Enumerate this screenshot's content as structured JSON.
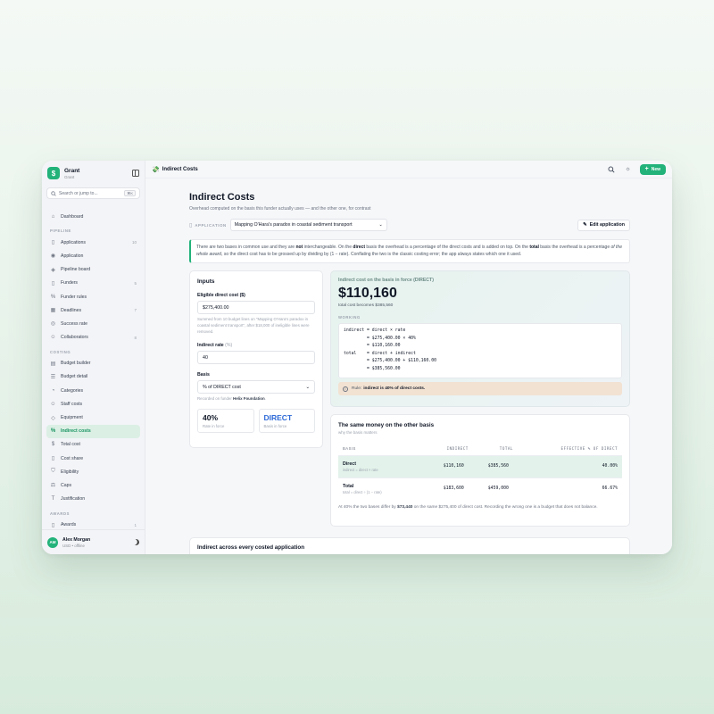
{
  "brand": {
    "name": "Grant",
    "sub": "Grant",
    "logo": "$"
  },
  "search": {
    "placeholder": "Search or jump to...",
    "shortcut": "⌘K"
  },
  "nav": {
    "dashboard": "Dashboard",
    "pipeline_section": "PIPELINE",
    "pipeline": [
      {
        "label": "Applications",
        "count": "10",
        "icon": "file-icon"
      },
      {
        "label": "Application",
        "count": "",
        "icon": "eye-icon"
      },
      {
        "label": "Pipeline board",
        "count": "",
        "icon": "layers-icon"
      },
      {
        "label": "Funders",
        "count": "5",
        "icon": "file-icon"
      },
      {
        "label": "Funder rules",
        "count": "",
        "icon": "percent-icon"
      },
      {
        "label": "Deadlines",
        "count": "7",
        "icon": "calendar-icon"
      },
      {
        "label": "Success rate",
        "count": "",
        "icon": "target-icon"
      },
      {
        "label": "Collaborators",
        "count": "8",
        "icon": "users-icon"
      }
    ],
    "costing_section": "COSTING",
    "costing": [
      {
        "label": "Budget builder",
        "icon": "table-icon"
      },
      {
        "label": "Budget detail",
        "icon": "list-icon"
      },
      {
        "label": "Categories",
        "icon": "pie-icon"
      },
      {
        "label": "Staff costs",
        "icon": "users-icon"
      },
      {
        "label": "Equipment",
        "icon": "box-icon"
      },
      {
        "label": "Indirect costs",
        "icon": "percent-icon"
      },
      {
        "label": "Total cost",
        "icon": "dollar-icon"
      },
      {
        "label": "Cost share",
        "icon": "file-icon"
      },
      {
        "label": "Eligibility",
        "icon": "shield-icon"
      },
      {
        "label": "Caps",
        "icon": "scale-icon"
      },
      {
        "label": "Justification",
        "icon": "type-icon"
      }
    ],
    "awards_section": "AWARDS",
    "awards": [
      {
        "label": "Awards",
        "count": "1"
      }
    ]
  },
  "user": {
    "initials": "AM",
    "name": "Alex Morgan",
    "sub": "USD • offline"
  },
  "topbar": {
    "title": "Indirect Costs",
    "emoji": "💸",
    "new_label": "New"
  },
  "page": {
    "title": "Indirect Costs",
    "subtitle": "Overhead computed on the basis this funder actually uses — and the other one, for contrast",
    "application_label": "APPLICATION",
    "application_value": "Mapping O'Hara's paradox in coastal sediment transport",
    "edit_label": "Edit application"
  },
  "inputs": {
    "title": "Inputs",
    "direct_label": "Eligible direct cost ($)",
    "direct_value": "$275,400.00",
    "direct_hint_1": "Summed from 10 budget lines on \"Mapping O'Hara's paradox in coastal sediment transport\", after $18,000 of ineligible lines were removed.",
    "rate_label": "Indirect rate",
    "rate_unit": "(%)",
    "rate_value": "40",
    "basis_label": "Basis",
    "basis_value": "% of DIRECT cost",
    "basis_hint_prefix": "Recorded on funder",
    "basis_hint_funder": "Helix Foundation",
    "rate_in_force": "40%",
    "rate_in_force_label": "Rate in force",
    "basis_in_force": "DIRECT",
    "basis_in_force_label": "Basis in force"
  },
  "result": {
    "label": "Indirect cost on the basis in force (DIRECT)",
    "amount": "$110,160",
    "total_note": "total cost becomes $385,560",
    "working_label": "WORKING",
    "working_lines": [
      "indirect = direct × rate",
      "         = $275,400.00 × 40%",
      "         = $110,160.00",
      "total    = direct + indirect",
      "         = $275,400.00 + $110,160.00",
      "         = $385,560.00"
    ],
    "rule_prefix": "Rule:",
    "rule_text": "indirect is 40% of direct costs."
  },
  "compare": {
    "title": "The same money on the other basis",
    "subtitle": "why the basis matters",
    "columns": [
      "BASIS",
      "INDIRECT",
      "TOTAL",
      "EFFECTIVE % OF DIRECT"
    ],
    "rows": [
      {
        "name": "Direct",
        "formula": "indirect = direct × rate",
        "indirect": "$110,160",
        "total": "$385,560",
        "effective": "40.00%"
      },
      {
        "name": "Total",
        "formula": "total = direct ÷ (1 − rate)",
        "indirect": "$183,600",
        "total": "$459,000",
        "effective": "66.67%"
      }
    ],
    "note_1": "At 40% the two bases differ by",
    "note_amount": "$73,440",
    "note_2": "on the same $275,400 of direct cost. Recording the wrong one is a budget that does not balance."
  },
  "bottom": {
    "title": "Indirect across every costed application"
  },
  "colors": {
    "accent": "#22b27a",
    "active_bg": "#dcefe5",
    "rule_bg": "#f2e2d2",
    "direct_blue": "#2f6bd8"
  }
}
